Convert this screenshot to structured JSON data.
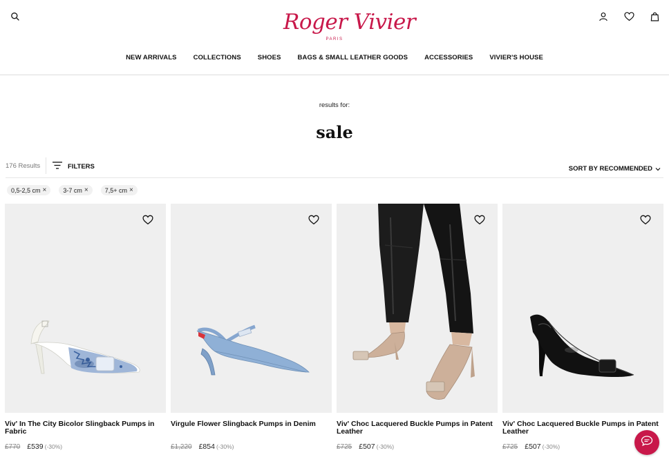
{
  "brand": {
    "name": "Roger Vivier",
    "sub": "PARIS",
    "color": "#c8184a"
  },
  "header": {
    "icons": {
      "search": "search-icon",
      "account": "user-icon",
      "wishlist": "heart-icon",
      "bag": "shopping-bag-icon"
    },
    "nav": [
      "NEW ARRIVALS",
      "COLLECTIONS",
      "SHOES",
      "BAGS & SMALL LEATHER GOODS",
      "ACCESSORIES",
      "VIVIER'S HOUSE"
    ]
  },
  "search": {
    "results_for_label": "results for:",
    "query": "sale"
  },
  "toolbar": {
    "result_count": "176 Results",
    "filters_label": "FILTERS",
    "sort_label": "SORT BY RECOMMENDED"
  },
  "chips": [
    {
      "label": "0,5-2,5 cm"
    },
    {
      "label": "3-7 cm"
    },
    {
      "label": "7,5+ cm"
    }
  ],
  "products": [
    {
      "name": "Viv' In The City Bicolor Slingback Pumps in Fabric",
      "old_price": "£770",
      "price": "£539",
      "discount": "(-30%)"
    },
    {
      "name": "Virgule Flower Slingback Pumps in Denim",
      "old_price": "£1,220",
      "price": "£854",
      "discount": "(-30%)"
    },
    {
      "name": "Viv' Choc Lacquered Buckle Pumps in Patent Leather",
      "old_price": "£725",
      "price": "£507",
      "discount": "(-30%)"
    },
    {
      "name": "Viv' Choc Lacquered Buckle Pumps in Patent Leather",
      "old_price": "£725",
      "price": "£507",
      "discount": "(-30%)"
    }
  ],
  "chat": {
    "icon": "chat-bubble-icon"
  }
}
